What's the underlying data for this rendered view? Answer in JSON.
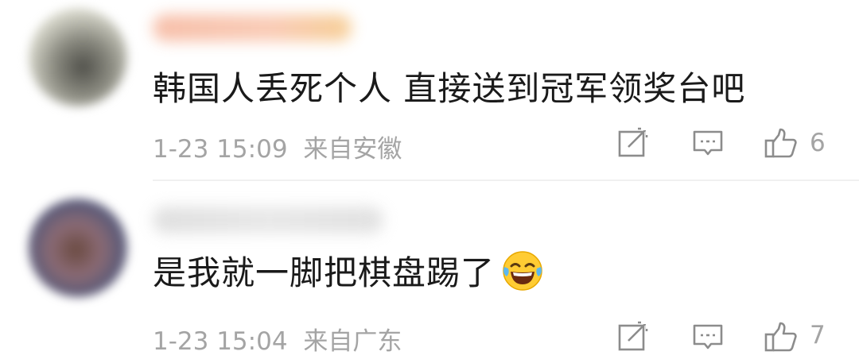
{
  "comments": [
    {
      "text": "韩国人丢死个人 直接送到冠军领奖台吧",
      "time": "1-23 15:09",
      "location": "来自安徽",
      "likes": "6"
    },
    {
      "text": "是我就一脚把棋盘踢了",
      "time": "1-23 15:04",
      "location": "来自广东",
      "likes": "7",
      "emoji": "laughing-tears-emoji"
    }
  ],
  "icons": {
    "share": "share-icon",
    "reply": "comment-icon",
    "like": "thumbs-up-icon"
  },
  "colors": {
    "text": "#1a1a1a",
    "meta": "#a4a4a4",
    "divider": "#f0f0f0"
  }
}
